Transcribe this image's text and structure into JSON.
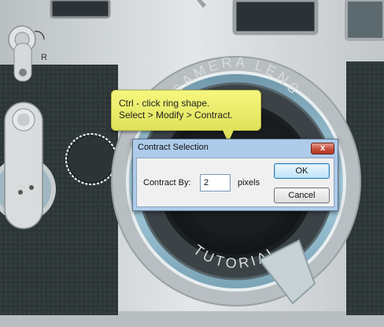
{
  "scene": {
    "engraving_top": "CAMERA LENS",
    "engraving_bottom": "TUTORIAL",
    "rewind_mark": "R"
  },
  "callout": {
    "line1": "Ctrl - click ring shape.",
    "line2": "Select > Modify > Contract."
  },
  "dialog": {
    "title": "Contract Selection",
    "close_label": "x",
    "field_label": "Contract By:",
    "field_value": "2",
    "unit_label": "pixels",
    "ok_label": "OK",
    "cancel_label": "Cancel"
  },
  "colors": {
    "leatherette": "#2e3739",
    "chrome": "#cdd2d4",
    "lens_ring_glow": "#8fb9cc",
    "callout_bg": "#eff06b",
    "dialog_frame": "#aecbea"
  },
  "icons": [
    "close-icon",
    "marching-ants-selection-icon"
  ]
}
